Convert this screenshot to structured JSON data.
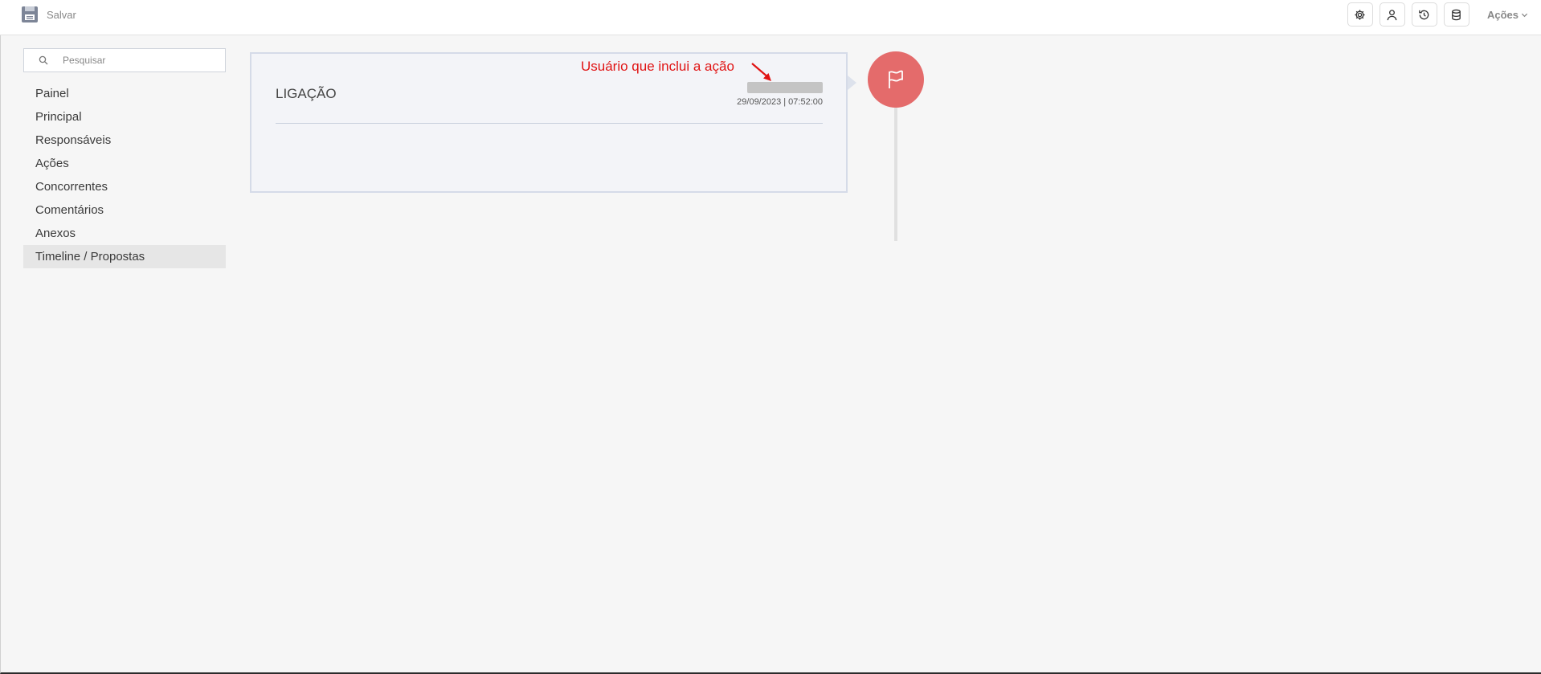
{
  "toolbar": {
    "save_label": "Salvar",
    "actions_label": "Ações"
  },
  "sidebar": {
    "search_placeholder": "Pesquisar",
    "items": [
      {
        "label": "Painel",
        "active": false
      },
      {
        "label": "Principal",
        "active": false
      },
      {
        "label": "Responsáveis",
        "active": false
      },
      {
        "label": "Ações",
        "active": false
      },
      {
        "label": "Concorrentes",
        "active": false
      },
      {
        "label": "Comentários",
        "active": false
      },
      {
        "label": "Anexos",
        "active": false
      },
      {
        "label": "Timeline / Propostas",
        "active": true
      }
    ]
  },
  "timeline": {
    "entry_title": "LIGAÇÃO",
    "entry_datetime": "29/09/2023 | 07:52:00",
    "annotation": "Usuário que inclui a ação"
  },
  "colors": {
    "marker": "#e46b6b",
    "annotation": "#e01414",
    "card_bg": "#f3f4f8"
  }
}
